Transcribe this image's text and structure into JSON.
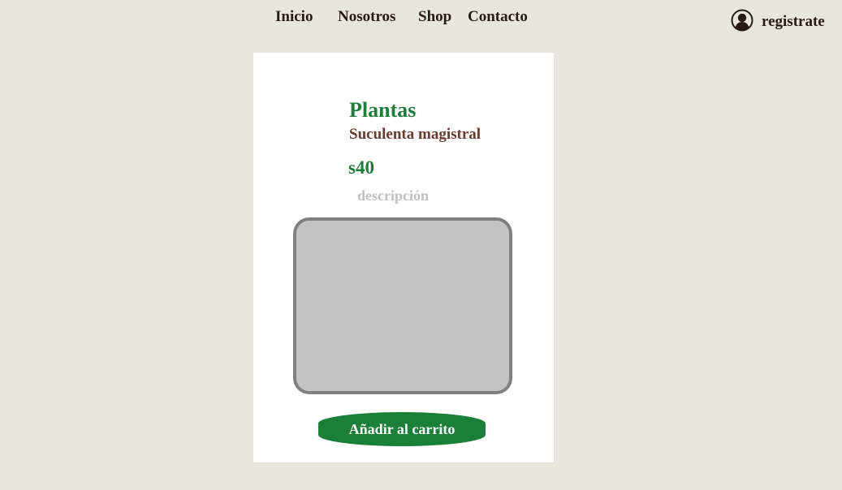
{
  "nav": {
    "items": [
      {
        "label": "Inicio"
      },
      {
        "label": "Nosotros"
      },
      {
        "label": "Shop"
      },
      {
        "label": "Contacto"
      }
    ],
    "register_label": "registrate",
    "register_icon": "user-circle-icon"
  },
  "product": {
    "category": "Plantas",
    "name": "Suculenta magistral",
    "price": "s40",
    "description": "descripción",
    "image_icon": "image-placeholder",
    "add_to_cart_label": "Añadir al carrito"
  },
  "colors": {
    "background": "#e9e6de",
    "card": "#ffffff",
    "accent_green": "#1a8038",
    "brown": "#6b3a2a",
    "dark_text": "#2a1a14",
    "placeholder_fill": "#c4c4c4",
    "placeholder_border": "#808080",
    "muted_text": "#c0c0c0"
  }
}
